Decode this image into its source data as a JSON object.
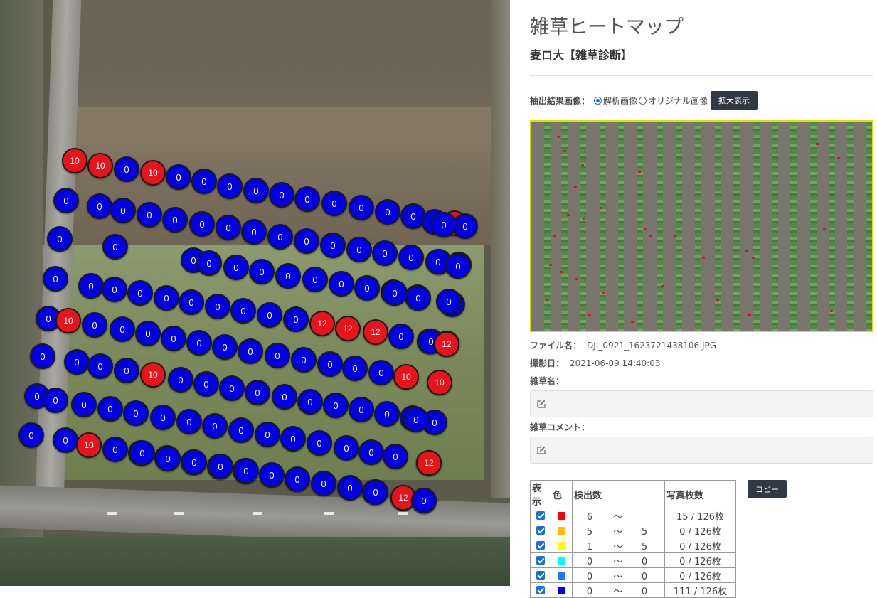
{
  "map": {
    "markers": [
      {
        "label": "10",
        "color": "red"
      },
      {
        "label": "10",
        "color": "red"
      },
      {
        "label": "0",
        "color": "blue"
      },
      {
        "label": "10",
        "color": "red"
      },
      {
        "label": "0",
        "color": "blue"
      },
      {
        "label": "0",
        "color": "blue"
      },
      {
        "label": "0",
        "color": "blue"
      },
      {
        "label": "0",
        "color": "blue"
      },
      {
        "label": "0",
        "color": "blue"
      },
      {
        "label": "0",
        "color": "blue"
      },
      {
        "label": "0",
        "color": "blue"
      },
      {
        "label": "0",
        "color": "blue"
      },
      {
        "label": "0",
        "color": "blue"
      },
      {
        "label": "0",
        "color": "blue"
      },
      {
        "label": "0",
        "color": "blue"
      },
      {
        "label": "0",
        "color": "blue"
      },
      {
        "label": "0",
        "color": "blue"
      },
      {
        "label": "0",
        "color": "blue"
      },
      {
        "label": "0",
        "color": "blue"
      },
      {
        "label": "0",
        "color": "blue"
      },
      {
        "label": "0",
        "color": "blue"
      },
      {
        "label": "0",
        "color": "blue"
      },
      {
        "label": "0",
        "color": "blue"
      },
      {
        "label": "0",
        "color": "blue"
      },
      {
        "label": "0",
        "color": "blue"
      },
      {
        "label": "0",
        "color": "blue"
      },
      {
        "label": "0",
        "color": "blue"
      },
      {
        "label": "0",
        "color": "blue"
      },
      {
        "label": "0",
        "color": "blue"
      },
      {
        "label": "",
        "color": "red"
      },
      {
        "label": "0",
        "color": "blue"
      },
      {
        "label": "0",
        "color": "blue"
      },
      {
        "label": "0",
        "color": "blue"
      },
      {
        "label": "0",
        "color": "blue"
      },
      {
        "label": "0",
        "color": "blue"
      },
      {
        "label": "0",
        "color": "blue"
      },
      {
        "label": "0",
        "color": "blue"
      },
      {
        "label": "0",
        "color": "blue"
      },
      {
        "label": "0",
        "color": "blue"
      },
      {
        "label": "0",
        "color": "blue"
      },
      {
        "label": "0",
        "color": "blue"
      },
      {
        "label": "0",
        "color": "blue"
      },
      {
        "label": "0",
        "color": "blue"
      },
      {
        "label": "0",
        "color": "blue"
      },
      {
        "label": "0",
        "color": "blue"
      },
      {
        "label": "0",
        "color": "blue"
      },
      {
        "label": "0",
        "color": "blue"
      },
      {
        "label": "0",
        "color": "blue"
      },
      {
        "label": "0",
        "color": "blue"
      },
      {
        "label": "0",
        "color": "blue"
      },
      {
        "label": "0",
        "color": "blue"
      },
      {
        "label": "0",
        "color": "blue"
      },
      {
        "label": "0",
        "color": "blue"
      },
      {
        "label": "0",
        "color": "blue"
      },
      {
        "label": "0",
        "color": "blue"
      },
      {
        "label": "0",
        "color": "blue"
      },
      {
        "label": "0",
        "color": "blue"
      },
      {
        "label": "12",
        "color": "red"
      },
      {
        "label": "12",
        "color": "red"
      },
      {
        "label": "12",
        "color": "red"
      },
      {
        "label": "0",
        "color": "blue"
      },
      {
        "label": "0",
        "color": "blue"
      },
      {
        "label": "0",
        "color": "blue"
      },
      {
        "label": "0",
        "color": "blue"
      },
      {
        "label": "0",
        "color": "blue"
      },
      {
        "label": "0",
        "color": "blue"
      },
      {
        "label": "0",
        "color": "blue"
      },
      {
        "label": "0",
        "color": "blue"
      },
      {
        "label": "0",
        "color": "blue"
      },
      {
        "label": "10",
        "color": "red"
      },
      {
        "label": "0",
        "color": "blue"
      },
      {
        "label": "0",
        "color": "blue"
      },
      {
        "label": "0",
        "color": "blue"
      },
      {
        "label": "0",
        "color": "blue"
      },
      {
        "label": "0",
        "color": "blue"
      },
      {
        "label": "0",
        "color": "blue"
      },
      {
        "label": "0",
        "color": "blue"
      },
      {
        "label": "0",
        "color": "blue"
      },
      {
        "label": "0",
        "color": "blue"
      },
      {
        "label": "0",
        "color": "blue"
      },
      {
        "label": "0",
        "color": "blue"
      },
      {
        "label": "0",
        "color": "blue"
      },
      {
        "label": "10",
        "color": "red"
      },
      {
        "label": "10",
        "color": "red"
      },
      {
        "label": "0",
        "color": "blue"
      },
      {
        "label": "12",
        "color": "red"
      },
      {
        "label": "0",
        "color": "blue"
      },
      {
        "label": "0",
        "color": "blue"
      },
      {
        "label": "0",
        "color": "blue"
      },
      {
        "label": "0",
        "color": "blue"
      },
      {
        "label": "10",
        "color": "red"
      },
      {
        "label": "0",
        "color": "blue"
      },
      {
        "label": "0",
        "color": "blue"
      },
      {
        "label": "0",
        "color": "blue"
      },
      {
        "label": "0",
        "color": "blue"
      },
      {
        "label": "0",
        "color": "blue"
      },
      {
        "label": "0",
        "color": "blue"
      },
      {
        "label": "0",
        "color": "blue"
      },
      {
        "label": "0",
        "color": "blue"
      },
      {
        "label": "0",
        "color": "blue"
      },
      {
        "label": "0",
        "color": "blue"
      },
      {
        "label": "0",
        "color": "blue"
      },
      {
        "label": "0",
        "color": "blue"
      },
      {
        "label": "0",
        "color": "blue"
      },
      {
        "label": "0",
        "color": "blue"
      },
      {
        "label": "0",
        "color": "blue"
      },
      {
        "label": "0",
        "color": "blue"
      },
      {
        "label": "0",
        "color": "blue"
      },
      {
        "label": "0",
        "color": "blue"
      },
      {
        "label": "0",
        "color": "blue"
      },
      {
        "label": "0",
        "color": "blue"
      },
      {
        "label": "0",
        "color": "blue"
      },
      {
        "label": "0",
        "color": "blue"
      },
      {
        "label": "0",
        "color": "blue"
      },
      {
        "label": "0",
        "color": "blue"
      },
      {
        "label": "0",
        "color": "blue"
      },
      {
        "label": "0",
        "color": "blue"
      },
      {
        "label": "0",
        "color": "blue"
      },
      {
        "label": "0",
        "color": "blue"
      },
      {
        "label": "0",
        "color": "blue"
      },
      {
        "label": "0",
        "color": "blue"
      },
      {
        "label": "10",
        "color": "red"
      },
      {
        "label": "0",
        "color": "blue"
      },
      {
        "label": "0",
        "color": "blue"
      },
      {
        "label": "0",
        "color": "blue"
      },
      {
        "label": "0",
        "color": "blue"
      },
      {
        "label": "0",
        "color": "blue"
      },
      {
        "label": "0",
        "color": "blue"
      },
      {
        "label": "0",
        "color": "blue"
      },
      {
        "label": "0",
        "color": "blue"
      },
      {
        "label": "0",
        "color": "blue"
      },
      {
        "label": "0",
        "color": "blue"
      },
      {
        "label": "0",
        "color": "blue"
      },
      {
        "label": "0",
        "color": "blue"
      },
      {
        "label": "0",
        "color": "blue"
      },
      {
        "label": "12",
        "color": "red"
      },
      {
        "label": "0",
        "color": "blue"
      },
      {
        "label": "0",
        "color": "blue"
      },
      {
        "label": "0",
        "color": "blue"
      },
      {
        "label": "0",
        "color": "blue"
      },
      {
        "label": "0",
        "color": "blue"
      },
      {
        "label": "0",
        "color": "blue"
      },
      {
        "label": "12",
        "color": "red"
      },
      {
        "label": "0",
        "color": "blue"
      },
      {
        "label": "0",
        "color": "blue"
      }
    ]
  },
  "panel": {
    "title": "雑草ヒートマップ",
    "subtitle": "麦ロ大【雑草診断】",
    "image_mode_label": "抽出結果画像：",
    "radio_analysis": "解析画像",
    "radio_original": "オリジナル画像",
    "selected_mode": "解析画像",
    "zoom_button": "拡大表示",
    "file_label": "ファイル名：",
    "file_name": "DJI_0921_1623721438106.JPG",
    "date_label": "撮影日：",
    "date": "2021-06-09 14:40:03",
    "weed_name_label": "雑草名：",
    "weed_name_value": "",
    "weed_comment_label": "雑草コメント：",
    "weed_comment_value": "",
    "copy_button": "コピー",
    "legend": {
      "headers": [
        "表示",
        "色",
        "検出数",
        "写真枚数"
      ],
      "rows": [
        {
          "checked": true,
          "color": "#ff0000",
          "from": "6",
          "tilde": "〜",
          "to": "",
          "photos": "15 / 126枚"
        },
        {
          "checked": true,
          "color": "#ffc000",
          "from": "5",
          "tilde": "〜",
          "to": "5",
          "photos": "0 / 126枚"
        },
        {
          "checked": true,
          "color": "#ffff00",
          "from": "1",
          "tilde": "〜",
          "to": "5",
          "photos": "0 / 126枚"
        },
        {
          "checked": true,
          "color": "#00ffff",
          "from": "0",
          "tilde": "〜",
          "to": "0",
          "photos": "0 / 126枚"
        },
        {
          "checked": true,
          "color": "#1e78ff",
          "from": "0",
          "tilde": "〜",
          "to": "0",
          "photos": "0 / 126枚"
        },
        {
          "checked": true,
          "color": "#0000ff",
          "from": "0",
          "tilde": "〜",
          "to": "0",
          "photos": "111 / 126枚"
        }
      ]
    }
  }
}
